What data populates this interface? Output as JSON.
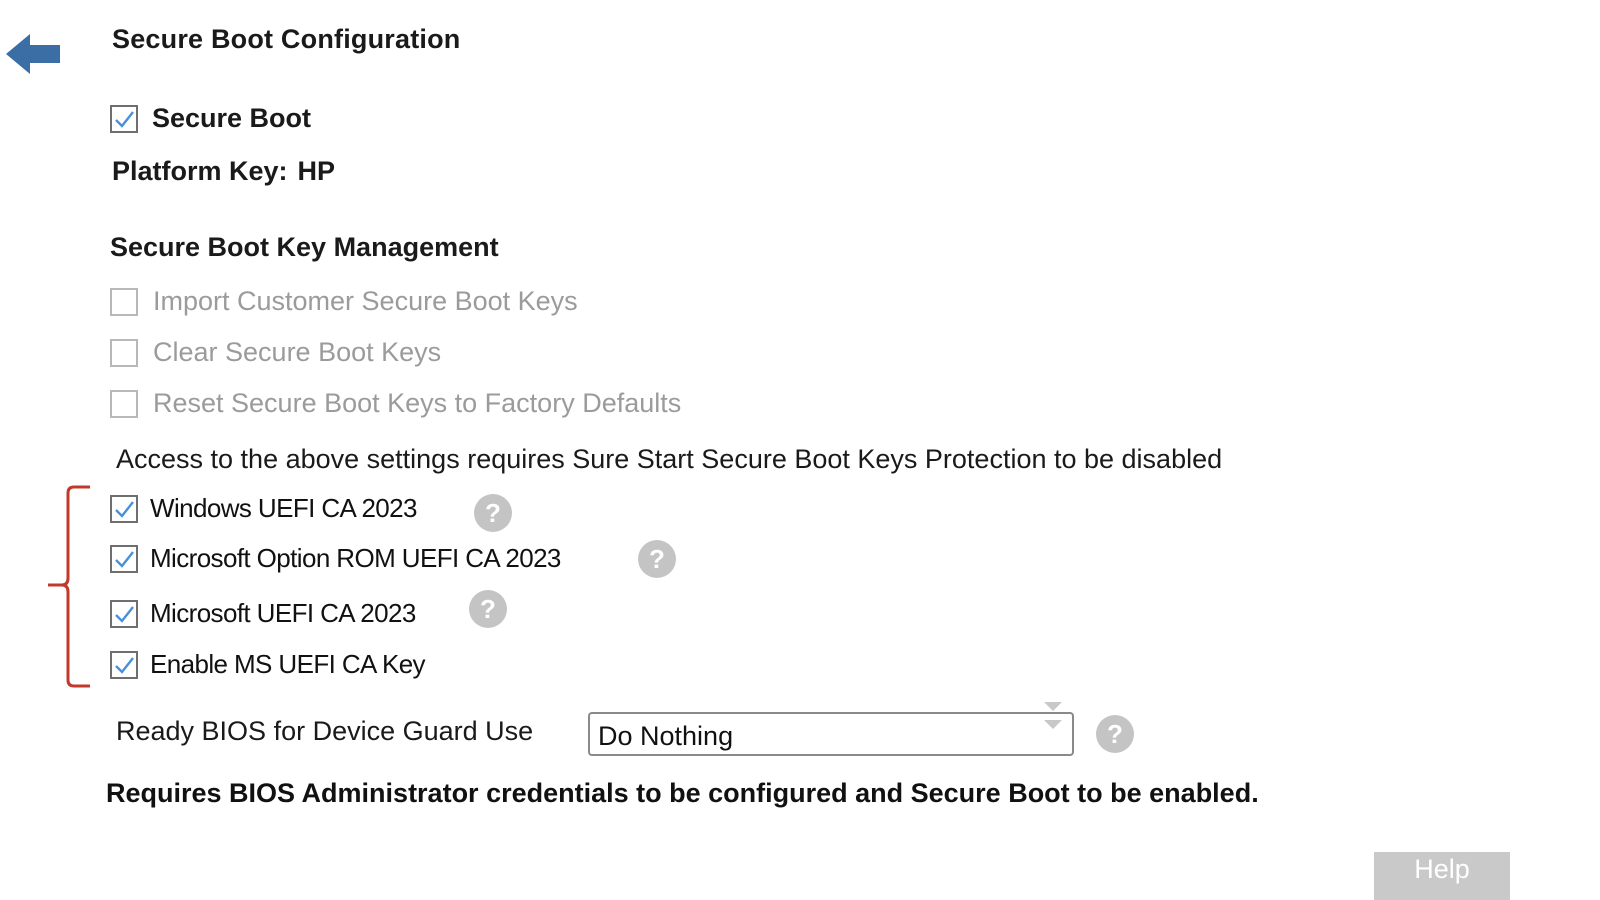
{
  "page": {
    "title": "Secure Boot Configuration",
    "back_icon": "back-arrow-icon"
  },
  "secure_boot": {
    "label": "Secure Boot",
    "checked": true
  },
  "platform_key": {
    "label": "Platform Key:",
    "value": "HP"
  },
  "key_management": {
    "heading": "Secure Boot Key Management",
    "items": [
      {
        "label": "Import Customer Secure Boot Keys",
        "checked": false,
        "disabled": true
      },
      {
        "label": "Clear Secure Boot Keys",
        "checked": false,
        "disabled": true
      },
      {
        "label": "Reset Secure Boot Keys to Factory Defaults",
        "checked": false,
        "disabled": true
      }
    ],
    "notice": "Access to the above settings requires Sure Start Secure Boot Keys Protection to be disabled"
  },
  "certificates": {
    "items": [
      {
        "label": "Windows UEFI CA 2023",
        "checked": true,
        "has_help": true
      },
      {
        "label": "Microsoft Option ROM UEFI CA 2023",
        "checked": true,
        "has_help": true
      },
      {
        "label": "Microsoft UEFI CA 2023",
        "checked": true,
        "has_help": true
      },
      {
        "label": "Enable MS UEFI CA Key",
        "checked": true,
        "has_help": false
      }
    ],
    "bracket_color": "#c0392b"
  },
  "device_guard": {
    "label": "Ready BIOS for Device Guard Use",
    "selected": "Do Nothing"
  },
  "requirement_text": "Requires BIOS Administrator credentials to be configured and Secure Boot to be enabled.",
  "help_glyph": "?",
  "help_button": {
    "label": "Help"
  },
  "colors": {
    "accent": "#3a6ea5",
    "check": "#4a90d9",
    "help_circle": "#c4c4c4",
    "disabled_text": "#9b9b9b"
  }
}
